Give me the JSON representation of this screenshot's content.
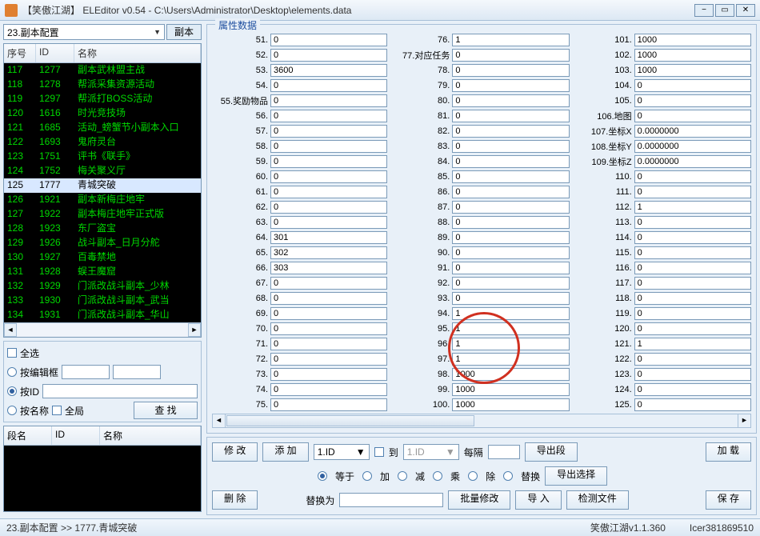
{
  "window": {
    "title": "【笑傲江湖】 ELEditor v0.54 - C:\\Users\\Administrator\\Desktop\\elements.data"
  },
  "category_combo": "23.副本配置",
  "category_btn": "副本",
  "list": {
    "cols": {
      "seq": "序号",
      "id": "ID",
      "name": "名称"
    },
    "rows": [
      {
        "seq": "117",
        "id": "1277",
        "name": "副本武林盟主战"
      },
      {
        "seq": "118",
        "id": "1278",
        "name": "帮派采集资源活动"
      },
      {
        "seq": "119",
        "id": "1297",
        "name": "帮派打BOSS活动"
      },
      {
        "seq": "120",
        "id": "1616",
        "name": "时光竞技场"
      },
      {
        "seq": "121",
        "id": "1685",
        "name": "活动_螃蟹节小副本入口"
      },
      {
        "seq": "122",
        "id": "1693",
        "name": "鬼府灵台"
      },
      {
        "seq": "123",
        "id": "1751",
        "name": "评书《联手》"
      },
      {
        "seq": "124",
        "id": "1752",
        "name": "梅关聚义厅"
      },
      {
        "seq": "125",
        "id": "1777",
        "name": "青城突破",
        "selected": true
      },
      {
        "seq": "126",
        "id": "1921",
        "name": "副本新梅庄地牢"
      },
      {
        "seq": "127",
        "id": "1922",
        "name": "副本梅庄地牢正式版"
      },
      {
        "seq": "128",
        "id": "1923",
        "name": "东厂盗宝"
      },
      {
        "seq": "129",
        "id": "1926",
        "name": "战斗副本_日月分舵"
      },
      {
        "seq": "130",
        "id": "1927",
        "name": "百毒禁地"
      },
      {
        "seq": "131",
        "id": "1928",
        "name": "蜈王魔窟"
      },
      {
        "seq": "132",
        "id": "1929",
        "name": "门派改战斗副本_少林"
      },
      {
        "seq": "133",
        "id": "1930",
        "name": "门派改战斗副本_武当"
      },
      {
        "seq": "134",
        "id": "1931",
        "name": "门派改战斗副本_华山"
      }
    ]
  },
  "filter": {
    "select_all": "全选",
    "by_box": "按编辑框",
    "by_id": "按ID",
    "by_name": "按名称",
    "global": "全局",
    "find": "查 找"
  },
  "segments": {
    "seg": "段名",
    "id": "ID",
    "name": "名称"
  },
  "props_title": "属性数据",
  "props": {
    "col1": [
      {
        "k": "51.",
        "v": "0"
      },
      {
        "k": "52.",
        "v": "0"
      },
      {
        "k": "53.",
        "v": "3600"
      },
      {
        "k": "54.",
        "v": "0"
      },
      {
        "k": "55.奖励物品",
        "v": "0"
      },
      {
        "k": "56.",
        "v": "0"
      },
      {
        "k": "57.",
        "v": "0"
      },
      {
        "k": "58.",
        "v": "0"
      },
      {
        "k": "59.",
        "v": "0"
      },
      {
        "k": "60.",
        "v": "0"
      },
      {
        "k": "61.",
        "v": "0"
      },
      {
        "k": "62.",
        "v": "0"
      },
      {
        "k": "63.",
        "v": "0"
      },
      {
        "k": "64.",
        "v": "301"
      },
      {
        "k": "65.",
        "v": "302"
      },
      {
        "k": "66.",
        "v": "303"
      },
      {
        "k": "67.",
        "v": "0"
      },
      {
        "k": "68.",
        "v": "0"
      },
      {
        "k": "69.",
        "v": "0"
      },
      {
        "k": "70.",
        "v": "0"
      },
      {
        "k": "71.",
        "v": "0"
      },
      {
        "k": "72.",
        "v": "0"
      },
      {
        "k": "73.",
        "v": "0"
      },
      {
        "k": "74.",
        "v": "0"
      },
      {
        "k": "75.",
        "v": "0"
      }
    ],
    "col2": [
      {
        "k": "76.",
        "v": "1"
      },
      {
        "k": "77.对应任务",
        "v": "0"
      },
      {
        "k": "78.",
        "v": "0"
      },
      {
        "k": "79.",
        "v": "0"
      },
      {
        "k": "80.",
        "v": "0"
      },
      {
        "k": "81.",
        "v": "0"
      },
      {
        "k": "82.",
        "v": "0"
      },
      {
        "k": "83.",
        "v": "0"
      },
      {
        "k": "84.",
        "v": "0"
      },
      {
        "k": "85.",
        "v": "0"
      },
      {
        "k": "86.",
        "v": "0"
      },
      {
        "k": "87.",
        "v": "0"
      },
      {
        "k": "88.",
        "v": "0"
      },
      {
        "k": "89.",
        "v": "0"
      },
      {
        "k": "90.",
        "v": "0"
      },
      {
        "k": "91.",
        "v": "0"
      },
      {
        "k": "92.",
        "v": "0"
      },
      {
        "k": "93.",
        "v": "0"
      },
      {
        "k": "94.",
        "v": "1"
      },
      {
        "k": "95.",
        "v": "1"
      },
      {
        "k": "96.",
        "v": "1"
      },
      {
        "k": "97.",
        "v": "1"
      },
      {
        "k": "98.",
        "v": "1000"
      },
      {
        "k": "99.",
        "v": "1000"
      },
      {
        "k": "100.",
        "v": "1000"
      }
    ],
    "col3": [
      {
        "k": "101.",
        "v": "1000"
      },
      {
        "k": "102.",
        "v": "1000"
      },
      {
        "k": "103.",
        "v": "1000"
      },
      {
        "k": "104.",
        "v": "0"
      },
      {
        "k": "105.",
        "v": "0"
      },
      {
        "k": "106.地图",
        "v": "0"
      },
      {
        "k": "107.坐标X",
        "v": "0.0000000"
      },
      {
        "k": "108.坐标Y",
        "v": "0.0000000"
      },
      {
        "k": "109.坐标Z",
        "v": "0.0000000"
      },
      {
        "k": "110.",
        "v": "0"
      },
      {
        "k": "111.",
        "v": "0"
      },
      {
        "k": "112.",
        "v": "1"
      },
      {
        "k": "113.",
        "v": "0"
      },
      {
        "k": "114.",
        "v": "0"
      },
      {
        "k": "115.",
        "v": "0"
      },
      {
        "k": "116.",
        "v": "0"
      },
      {
        "k": "117.",
        "v": "0"
      },
      {
        "k": "118.",
        "v": "0"
      },
      {
        "k": "119.",
        "v": "0"
      },
      {
        "k": "120.",
        "v": "0"
      },
      {
        "k": "121.",
        "v": "1"
      },
      {
        "k": "122.",
        "v": "0"
      },
      {
        "k": "123.",
        "v": "0"
      },
      {
        "k": "124.",
        "v": "0"
      },
      {
        "k": "125.",
        "v": "0"
      }
    ]
  },
  "actions": {
    "modify": "修 改",
    "add": "添 加",
    "delete": "删 除",
    "id_combo": "1.ID",
    "to_chk": "到",
    "to_ph": "1.ID",
    "every": "每隔",
    "eq": "等于",
    "plus": "加",
    "minus": "减",
    "mul": "乘",
    "div": "除",
    "replace": "替换",
    "export_seg": "导出段",
    "export_sel": "导出选择",
    "import": "导 入",
    "check_file": "检测文件",
    "load": "加 载",
    "save": "保 存",
    "replace_to": "替换为",
    "batch_modify": "批量修改"
  },
  "statusbar": {
    "path": "23.副本配置 >> 1777.青城突破",
    "app": "笑傲江湖v1.1.360",
    "author": "Icer381869510"
  }
}
